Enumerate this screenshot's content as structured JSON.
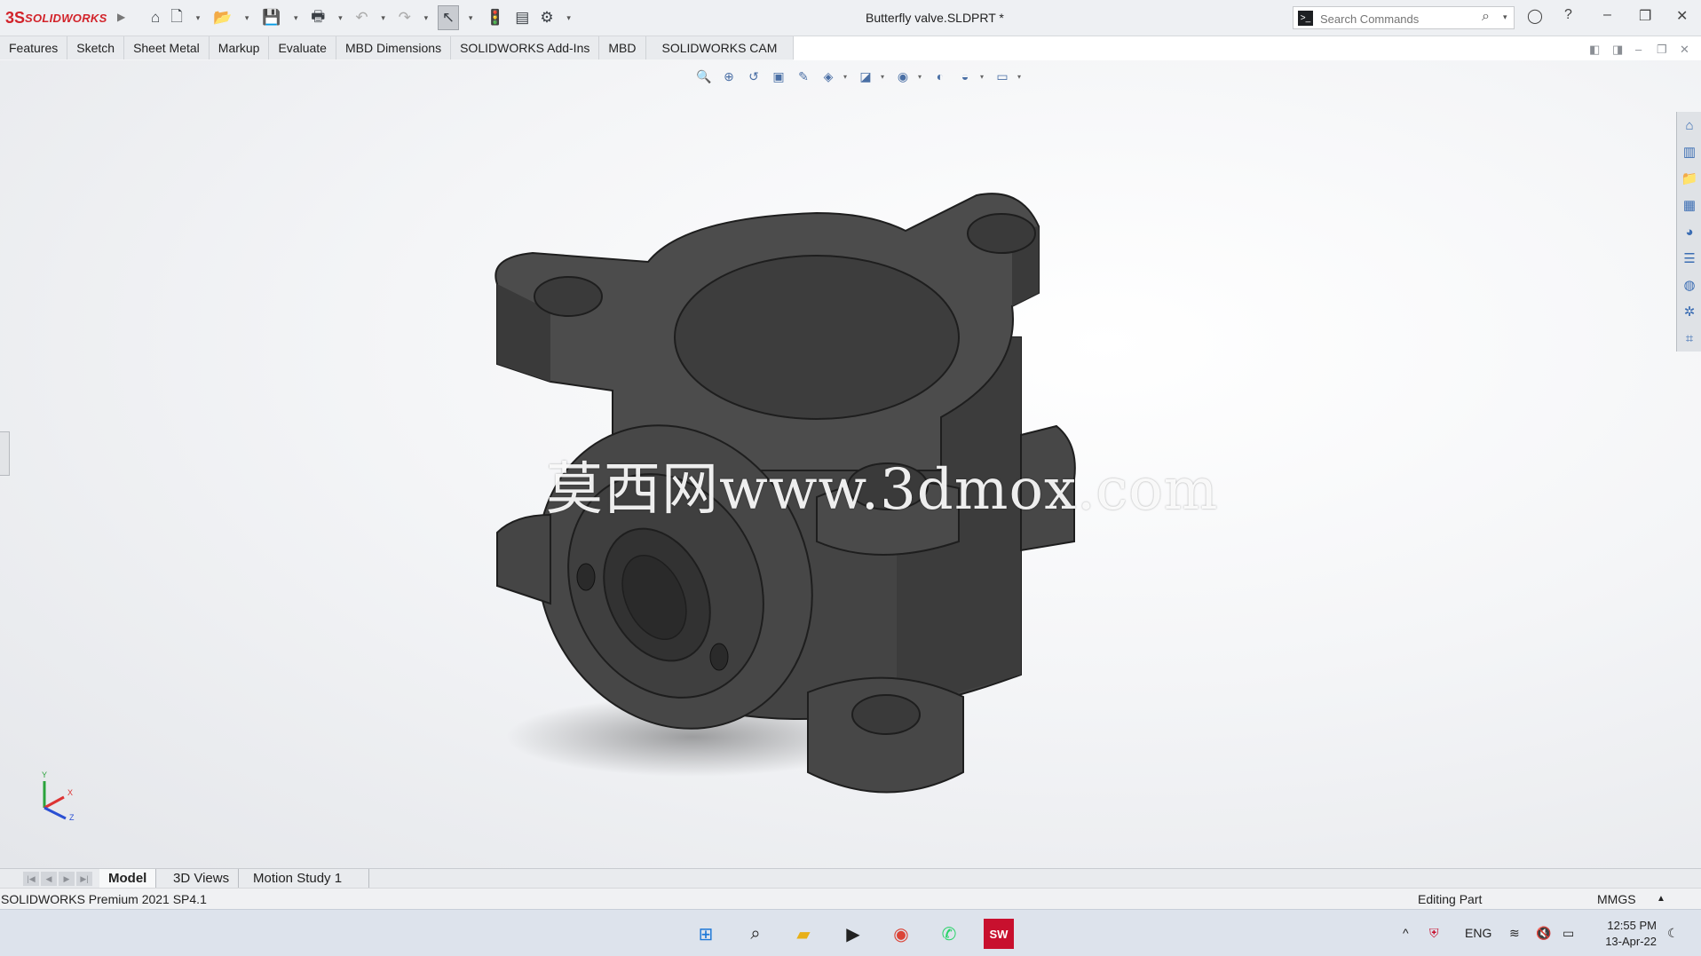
{
  "app": {
    "logo_mark": "3S",
    "logo_brand": "SOLIDWORKS",
    "window_title": "Butterfly valve.SLDPRT *"
  },
  "search": {
    "placeholder": "Search Commands"
  },
  "ribbon": {
    "tabs": [
      {
        "label": "Features"
      },
      {
        "label": "Sketch"
      },
      {
        "label": "Sheet Metal"
      },
      {
        "label": "Markup"
      },
      {
        "label": "Evaluate"
      },
      {
        "label": "MBD Dimensions"
      },
      {
        "label": "SOLIDWORKS Add-Ins"
      },
      {
        "label": "MBD"
      },
      {
        "label": "SOLIDWORKS CAM"
      }
    ]
  },
  "viewport": {
    "watermark": "莫西网www.3dmox.com",
    "model_color": "#4a4a4a",
    "triad": {
      "x": "X",
      "y": "Y",
      "z": "Z"
    }
  },
  "bottom_tabs": [
    {
      "label": "Model",
      "active": true
    },
    {
      "label": "3D Views",
      "active": false
    },
    {
      "label": "Motion Study 1",
      "active": false
    }
  ],
  "status": {
    "version": "SOLIDWORKS Premium 2021 SP4.1",
    "mode": "Editing Part",
    "units": "MMGS"
  },
  "taskbar": {
    "language": "ENG",
    "time": "12:55 PM",
    "date": "13-Apr-22"
  },
  "colors": {
    "brand_red": "#d2232a",
    "accent_blue": "#3b6db3"
  }
}
